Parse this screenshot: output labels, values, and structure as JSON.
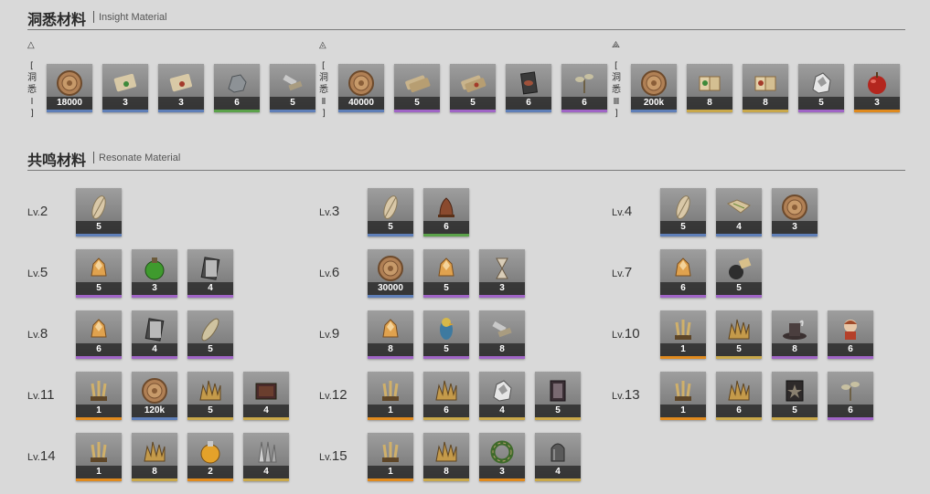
{
  "insight": {
    "title_zh": "洞悉材料",
    "title_en": "Insight Material",
    "tiers": [
      {
        "icon": "△",
        "label": [
          "[",
          "洞",
          "悉",
          "Ⅰ",
          "]"
        ],
        "items": [
          {
            "icon": "coin",
            "count": "18000",
            "rarity": "blue"
          },
          {
            "icon": "scroll-green",
            "count": "3",
            "rarity": "blue"
          },
          {
            "icon": "scroll-red",
            "count": "3",
            "rarity": "blue"
          },
          {
            "icon": "ore",
            "count": "6",
            "rarity": "green"
          },
          {
            "icon": "tools",
            "count": "5",
            "rarity": "blue"
          }
        ]
      },
      {
        "icon": "◬",
        "label": [
          "[",
          "洞",
          "悉",
          "Ⅱ",
          "]"
        ],
        "items": [
          {
            "icon": "coin",
            "count": "40000",
            "rarity": "blue"
          },
          {
            "icon": "scroll-bundle",
            "count": "5",
            "rarity": "purple"
          },
          {
            "icon": "scroll-bundle-red",
            "count": "5",
            "rarity": "purple"
          },
          {
            "icon": "card",
            "count": "6",
            "rarity": "blue"
          },
          {
            "icon": "sprout",
            "count": "6",
            "rarity": "purple"
          }
        ]
      },
      {
        "icon": "⟁",
        "label": [
          "[",
          "洞",
          "悉",
          "Ⅲ",
          "]"
        ],
        "items": [
          {
            "icon": "coin",
            "count": "200k",
            "rarity": "blue"
          },
          {
            "icon": "book-green",
            "count": "8",
            "rarity": "gold"
          },
          {
            "icon": "book-red",
            "count": "8",
            "rarity": "gold"
          },
          {
            "icon": "ore-white",
            "count": "5",
            "rarity": "purple"
          },
          {
            "icon": "apple-red",
            "count": "3",
            "rarity": "orange"
          }
        ]
      }
    ]
  },
  "resonate": {
    "title_zh": "共鸣材料",
    "title_en": "Resonate Material",
    "lv_prefix": "Lv.",
    "levels": [
      {
        "level": "2",
        "items": [
          {
            "icon": "feather",
            "count": "5",
            "rarity": "blue"
          }
        ]
      },
      {
        "level": "3",
        "items": [
          {
            "icon": "feather",
            "count": "5",
            "rarity": "blue"
          },
          {
            "icon": "bell",
            "count": "6",
            "rarity": "green"
          }
        ]
      },
      {
        "level": "4",
        "items": [
          {
            "icon": "feather",
            "count": "5",
            "rarity": "blue"
          },
          {
            "icon": "map",
            "count": "4",
            "rarity": "blue"
          },
          {
            "icon": "coin",
            "count": "3",
            "rarity": "blue"
          }
        ]
      },
      {
        "level": "5",
        "items": [
          {
            "icon": "crystal-orange",
            "count": "5",
            "rarity": "purple"
          },
          {
            "icon": "potion-green",
            "count": "3",
            "rarity": "purple"
          },
          {
            "icon": "stone-slab",
            "count": "4",
            "rarity": "purple"
          }
        ]
      },
      {
        "level": "6",
        "items": [
          {
            "icon": "coin",
            "count": "30000",
            "rarity": "blue"
          },
          {
            "icon": "crystal-orange",
            "count": "5",
            "rarity": "purple"
          },
          {
            "icon": "hourglass",
            "count": "3",
            "rarity": "purple"
          }
        ]
      },
      {
        "level": "7",
        "items": [
          {
            "icon": "crystal-orange",
            "count": "6",
            "rarity": "purple"
          },
          {
            "icon": "bomb",
            "count": "5",
            "rarity": "purple"
          }
        ]
      },
      {
        "level": "8",
        "items": [
          {
            "icon": "crystal-orange",
            "count": "6",
            "rarity": "purple"
          },
          {
            "icon": "stone-slab",
            "count": "4",
            "rarity": "purple"
          },
          {
            "icon": "leaf",
            "count": "5",
            "rarity": "purple"
          }
        ]
      },
      {
        "level": "9",
        "items": [
          {
            "icon": "crystal-orange",
            "count": "8",
            "rarity": "purple"
          },
          {
            "icon": "parrot",
            "count": "5",
            "rarity": "purple"
          },
          {
            "icon": "tools",
            "count": "8",
            "rarity": "purple"
          }
        ]
      },
      {
        "level": "10",
        "items": [
          {
            "icon": "wheat-gold",
            "count": "1",
            "rarity": "orange"
          },
          {
            "icon": "crystal-gold",
            "count": "5",
            "rarity": "gold"
          },
          {
            "icon": "hat",
            "count": "8",
            "rarity": "purple"
          },
          {
            "icon": "doll",
            "count": "6",
            "rarity": "purple"
          }
        ]
      },
      {
        "level": "11",
        "items": [
          {
            "icon": "wheat-gold",
            "count": "1",
            "rarity": "orange"
          },
          {
            "icon": "coin",
            "count": "120k",
            "rarity": "blue"
          },
          {
            "icon": "crystal-gold",
            "count": "5",
            "rarity": "gold"
          },
          {
            "icon": "box",
            "count": "4",
            "rarity": "gold"
          }
        ]
      },
      {
        "level": "12",
        "items": [
          {
            "icon": "wheat-gold",
            "count": "1",
            "rarity": "orange"
          },
          {
            "icon": "crystal-gold",
            "count": "6",
            "rarity": "gold"
          },
          {
            "icon": "ore-white",
            "count": "4",
            "rarity": "gold"
          },
          {
            "icon": "frame",
            "count": "5",
            "rarity": "gold"
          }
        ]
      },
      {
        "level": "13",
        "items": [
          {
            "icon": "wheat-gold",
            "count": "1",
            "rarity": "orange"
          },
          {
            "icon": "crystal-gold",
            "count": "6",
            "rarity": "gold"
          },
          {
            "icon": "tome",
            "count": "5",
            "rarity": "gold"
          },
          {
            "icon": "sprout",
            "count": "6",
            "rarity": "purple"
          }
        ]
      },
      {
        "level": "14",
        "items": [
          {
            "icon": "wheat-gold",
            "count": "1",
            "rarity": "orange"
          },
          {
            "icon": "crystal-gold",
            "count": "8",
            "rarity": "gold"
          },
          {
            "icon": "potion-orange",
            "count": "2",
            "rarity": "orange"
          },
          {
            "icon": "blades",
            "count": "4",
            "rarity": "gold"
          }
        ]
      },
      {
        "level": "15",
        "items": [
          {
            "icon": "wheat-gold",
            "count": "1",
            "rarity": "orange"
          },
          {
            "icon": "crystal-gold",
            "count": "8",
            "rarity": "gold"
          },
          {
            "icon": "wreath",
            "count": "3",
            "rarity": "orange"
          },
          {
            "icon": "bell-jar",
            "count": "4",
            "rarity": "gold"
          }
        ]
      }
    ]
  },
  "rarity_colors": {
    "blue": "#5f7fb8",
    "green": "#5ba24a",
    "purple": "#a065c6",
    "gold": "#c9a84a",
    "orange": "#e08a1e"
  }
}
